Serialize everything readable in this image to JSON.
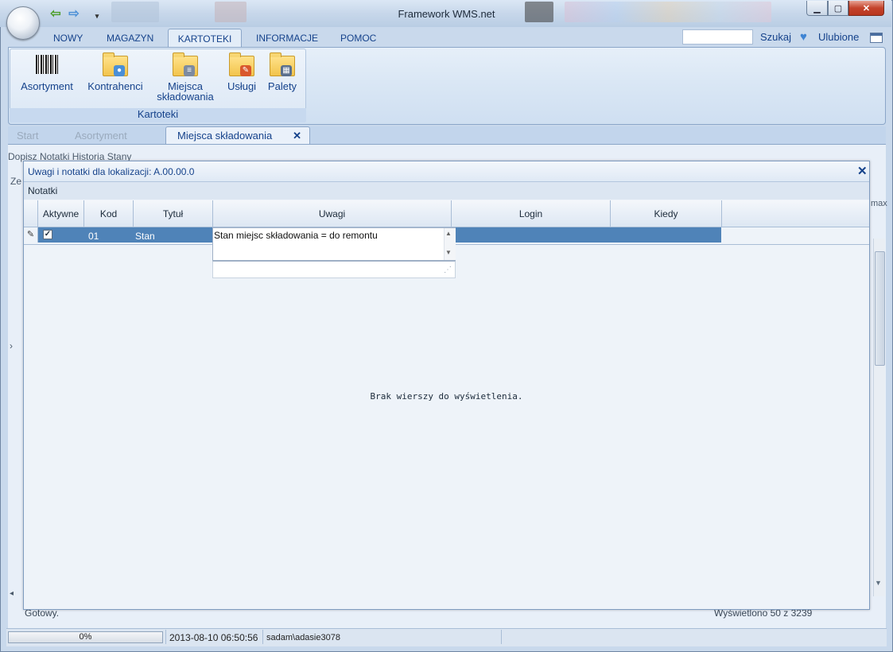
{
  "app": {
    "title": "Framework WMS.net"
  },
  "ribbon": {
    "tabs": [
      "NOWY",
      "MAGAZYN",
      "KARTOTEKI",
      "INFORMACJE",
      "POMOC"
    ],
    "active_tab": "KARTOTEKI",
    "search_label": "Szukaj",
    "favorites_label": "Ulubione",
    "group": {
      "label": "Kartoteki",
      "buttons": [
        {
          "label": "Asortyment",
          "icon": "barcode-icon"
        },
        {
          "label": "Kontrahenci",
          "icon": "contacts-folder-icon"
        },
        {
          "label1": "Miejsca",
          "label2": "składowania",
          "icon": "database-folder-icon"
        },
        {
          "label": "Usługi",
          "icon": "pencil-folder-icon"
        },
        {
          "label": "Palety",
          "icon": "pallet-folder-icon"
        }
      ]
    }
  },
  "doc_tabs": {
    "items": [
      "Start",
      "Asortyment"
    ],
    "active": "Miejsca składowania"
  },
  "background": {
    "toolbar": "Dopisz  Notatki  Historia  Stany",
    "left_label": "Ze",
    "right_label": "max",
    "status_left": "Gotowy.",
    "status_right": "Wyświetlono 50 z 3239"
  },
  "dialog": {
    "title": "Uwagi i notatki dla lokalizacji: A.00.00.0",
    "section": "Notatki",
    "columns": [
      "Aktywne",
      "Kod",
      "Tytuł",
      "Uwagi",
      "Login",
      "Kiedy"
    ],
    "row": {
      "active": true,
      "kod": "01",
      "tytul": "Stan",
      "uwagi": "Stan miejsc składowania = do remontu",
      "login": "",
      "kiedy": ""
    },
    "empty_message": "Brak wierszy do wyświetlenia."
  },
  "statusbar": {
    "progress": "0%",
    "progress_value": 0,
    "timestamp": "2013-08-10 06:50:56",
    "user": "sadam\\adasie3078"
  },
  "colors": {
    "accent": "#15428b",
    "selected_row": "#4f83b8",
    "ribbon_bg": "#dae7f5"
  }
}
